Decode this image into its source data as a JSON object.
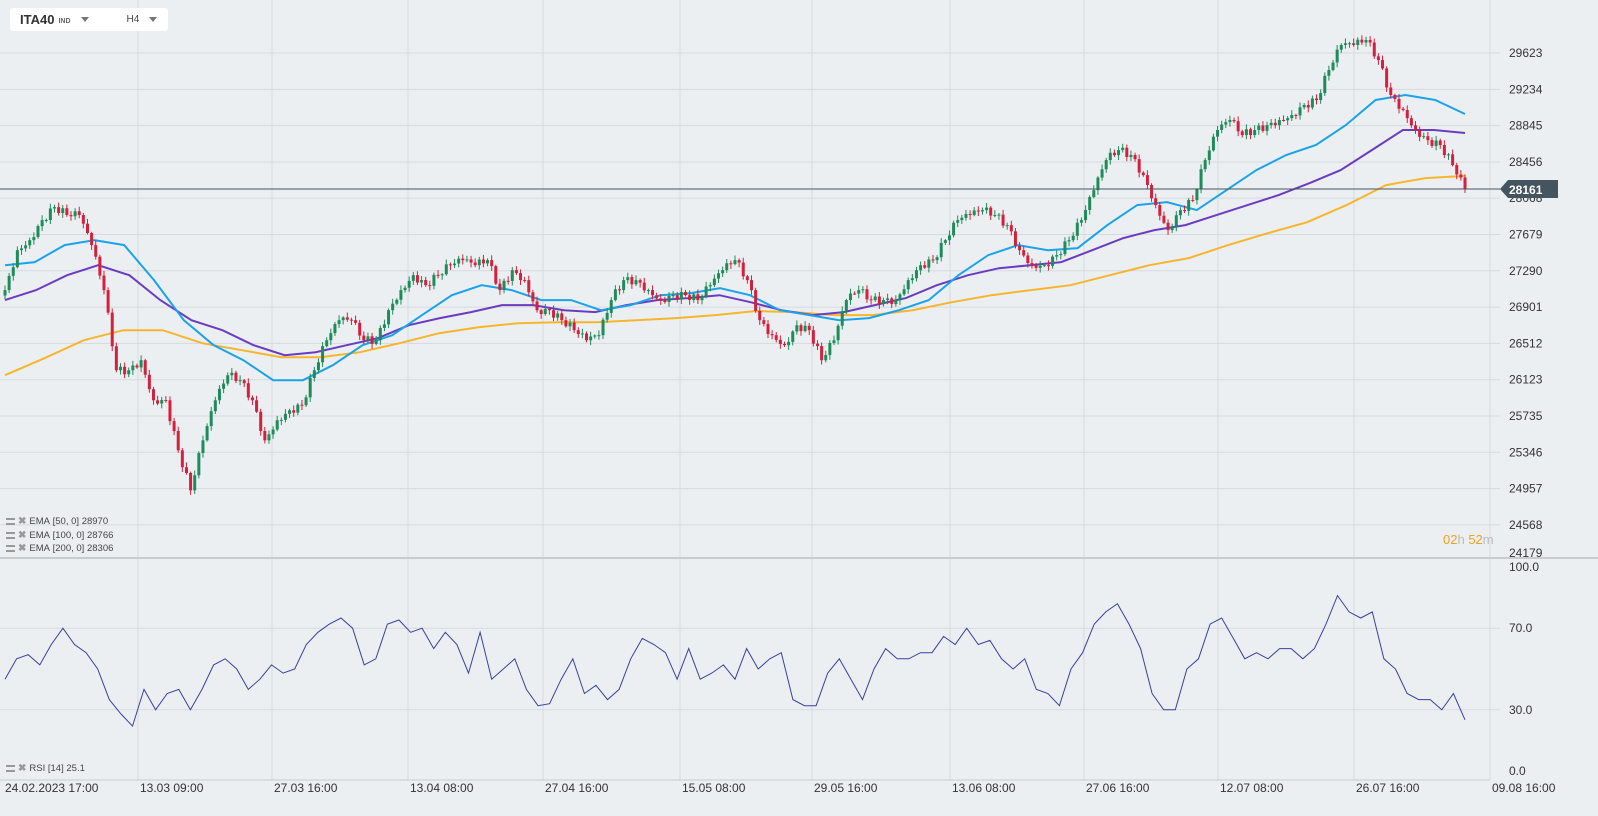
{
  "header": {
    "symbol": "ITA40",
    "symbol_type": "IND",
    "timeframe": "H4"
  },
  "current_price": "28161",
  "countdown": {
    "hours": "02",
    "h_unit": "h",
    "minutes": "52",
    "m_unit": "m"
  },
  "legend": [
    {
      "label": "EMA",
      "params": "[50,  0]",
      "value": "28970"
    },
    {
      "label": "EMA",
      "params": "[100,  0]",
      "value": "28766"
    },
    {
      "label": "EMA",
      "params": "[200,  0]",
      "value": "28306"
    }
  ],
  "rsi_legend": {
    "label": "RSI",
    "params": "[14]",
    "value": "25.1"
  },
  "colors": {
    "up": "#1e8c5a",
    "down": "#d3203c",
    "ema50": "#1aa3e8",
    "ema100": "#6a3cc0",
    "ema200": "#f7b52c",
    "rsi": "#3b3fa0",
    "price_tag": "#455560"
  },
  "chart_data": [
    {
      "type": "candlestick",
      "title": "ITA40 H4",
      "y_ticks": [
        "29623",
        "29234",
        "28845",
        "28456",
        "28068",
        "27679",
        "27290",
        "26901",
        "26512",
        "26123",
        "25735",
        "25346",
        "24957",
        "24568",
        "24179"
      ],
      "ylim": [
        24179,
        29623
      ],
      "x_ticks": [
        "24.02.2023 17:00",
        "13.03 09:00",
        "27.03 16:00",
        "13.04 08:00",
        "27.04 16:00",
        "15.05 08:00",
        "29.05 16:00",
        "13.06 08:00",
        "27.06 16:00",
        "12.07 08:00",
        "26.07 16:00",
        "09.08 16:00"
      ],
      "closes": [
        27083,
        27511,
        27618,
        27833,
        27972,
        27887,
        27887,
        27565,
        27083,
        26225,
        26225,
        26332,
        25903,
        25903,
        25367,
        24938,
        25474,
        25903,
        26171,
        26118,
        25903,
        25474,
        25689,
        25796,
        25850,
        26225,
        26546,
        26761,
        26761,
        26546,
        26546,
        26868,
        27083,
        27243,
        27136,
        27243,
        27350,
        27404,
        27350,
        27404,
        27083,
        27297,
        27190,
        26868,
        26868,
        26761,
        26654,
        26546,
        26600,
        26976,
        27190,
        27190,
        27083,
        26976,
        27029,
        27029,
        26976,
        27136,
        27297,
        27404,
        27190,
        26761,
        26600,
        26493,
        26707,
        26654,
        26332,
        26546,
        26976,
        27083,
        26976,
        26976,
        26976,
        27190,
        27350,
        27404,
        27618,
        27833,
        27887,
        27940,
        27887,
        27779,
        27511,
        27350,
        27350,
        27458,
        27618,
        27833,
        28154,
        28476,
        28583,
        28530,
        28315,
        27994,
        27726,
        27940,
        28047,
        28476,
        28798,
        28905,
        28744,
        28798,
        28851,
        28905,
        28959,
        29066,
        29119,
        29441,
        29709,
        29709,
        29762,
        29548,
        29173,
        29012,
        28798,
        28690,
        28637,
        28422,
        28161
      ],
      "ema50": [
        27350,
        27383,
        27565,
        27618,
        27565,
        27190,
        26761,
        26493,
        26332,
        26118,
        26118,
        26279,
        26493,
        26600,
        26815,
        27029,
        27136,
        27083,
        26976,
        26976,
        26868,
        26922,
        27029,
        27050,
        27104,
        27029,
        26868,
        26815,
        26761,
        26783,
        26868,
        26976,
        27243,
        27458,
        27565,
        27511,
        27533,
        27779,
        27994,
        28026,
        27940,
        28154,
        28369,
        28530,
        28637,
        28851,
        29119,
        29173,
        29119,
        28970
      ],
      "ema100": [
        26976,
        27083,
        27243,
        27350,
        27243,
        26976,
        26761,
        26654,
        26493,
        26386,
        26418,
        26493,
        26568,
        26707,
        26783,
        26847,
        26922,
        26922,
        26868,
        26847,
        26922,
        26976,
        26997,
        27029,
        26954,
        26868,
        26815,
        26847,
        26922,
        26997,
        27136,
        27243,
        27318,
        27350,
        27383,
        27511,
        27640,
        27726,
        27779,
        27887,
        27994,
        28101,
        28229,
        28369,
        28583,
        28798,
        28798,
        28766
      ],
      "ema200": [
        26171,
        26354,
        26546,
        26654,
        26654,
        26514,
        26439,
        26364,
        26364,
        26418,
        26514,
        26621,
        26686,
        26729,
        26739,
        26739,
        26761,
        26783,
        26815,
        26858,
        26847,
        26815,
        26815,
        26868,
        26954,
        27029,
        27083,
        27136,
        27243,
        27350,
        27426,
        27565,
        27693,
        27811,
        27994,
        28208,
        28283,
        28306
      ]
    },
    {
      "type": "line",
      "title": "RSI [14]",
      "y_ticks": [
        "100.0",
        "70.0",
        "30.0",
        "0.0"
      ],
      "ylim": [
        0,
        100
      ],
      "values": [
        45,
        55,
        57,
        52,
        62,
        70,
        62,
        58,
        50,
        35,
        28,
        22,
        40,
        30,
        38,
        40,
        30,
        40,
        52,
        55,
        50,
        40,
        45,
        52,
        48,
        50,
        62,
        68,
        72,
        75,
        70,
        52,
        55,
        72,
        74,
        68,
        70,
        60,
        68,
        62,
        48,
        68,
        45,
        50,
        55,
        40,
        32,
        33,
        45,
        55,
        38,
        42,
        35,
        40,
        55,
        65,
        62,
        58,
        45,
        60,
        45,
        48,
        52,
        45,
        60,
        50,
        55,
        58,
        35,
        32,
        32,
        48,
        55,
        45,
        35,
        50,
        60,
        55,
        55,
        58,
        58,
        66,
        62,
        70,
        62,
        64,
        55,
        50,
        55,
        40,
        38,
        32,
        50,
        58,
        72,
        78,
        82,
        72,
        60,
        38,
        30,
        30,
        50,
        55,
        72,
        75,
        65,
        55,
        58,
        55,
        60,
        60,
        55,
        60,
        72,
        86,
        78,
        75,
        78,
        55,
        50,
        38,
        35,
        35,
        30,
        38,
        25.1
      ]
    }
  ]
}
